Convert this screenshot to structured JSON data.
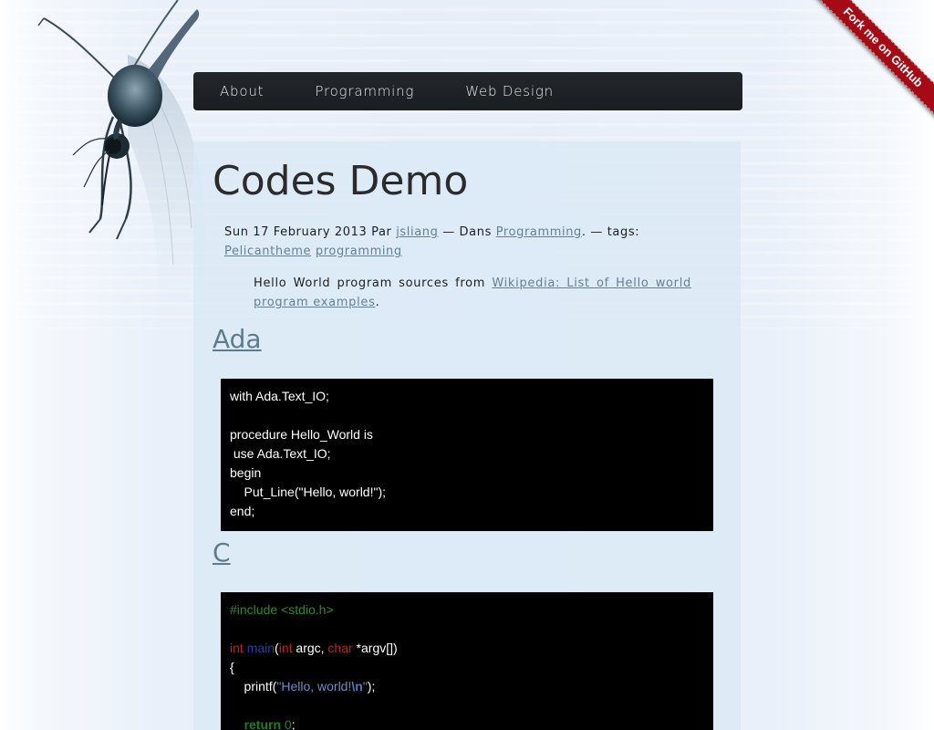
{
  "site": {
    "title": ""
  },
  "nav": {
    "items": [
      "About",
      "Programming",
      "Web Design"
    ]
  },
  "ribbon": {
    "label": "Fork me on GitHub"
  },
  "article": {
    "title": "Codes Demo",
    "meta": {
      "date": "Sun 17 February 2013",
      "by_label": "Par",
      "author": "jsliang",
      "in_label": "— Dans",
      "category": "Programming",
      "tags_label": ". — tags:",
      "tags": [
        "Pelican",
        "theme",
        "programming"
      ]
    },
    "intro": {
      "text": "Hello World program sources from",
      "link": "Wikipedia: List of Hello world program examples",
      "end": "."
    },
    "sections": [
      {
        "heading": "Ada",
        "code": [
          "with Ada.Text_IO;",
          "",
          "procedure Hello_World is",
          " use Ada.Text_IO;",
          "begin",
          "    Put_Line(\"Hello, world!\");",
          "end;"
        ]
      },
      {
        "heading": "C",
        "code": {
          "include": "#include <stdio.h>",
          "int_kw": "int",
          "main_fn": "main",
          "open_paren": "(",
          "int_kw2": "int",
          "argc": " argc, ",
          "char_kw": "char",
          "argv": " *argv[])",
          "open_brace": "{",
          "printf_open": "    printf(",
          "str_part": "\"Hello, world!",
          "esc": "\\n",
          "str_close": "\"",
          "printf_close": ");",
          "return_indent": "    ",
          "return_kw": "return",
          "return_val": "0",
          "return_end": ";"
        }
      }
    ]
  },
  "colors": {
    "nav_bg": "#1d2125",
    "link": "#66808f",
    "ribbon": "#a60a14",
    "content_bg": "#dae9f6",
    "code_bg": "#000000"
  },
  "icons": {
    "mosquito": "mosquito-illustration"
  }
}
